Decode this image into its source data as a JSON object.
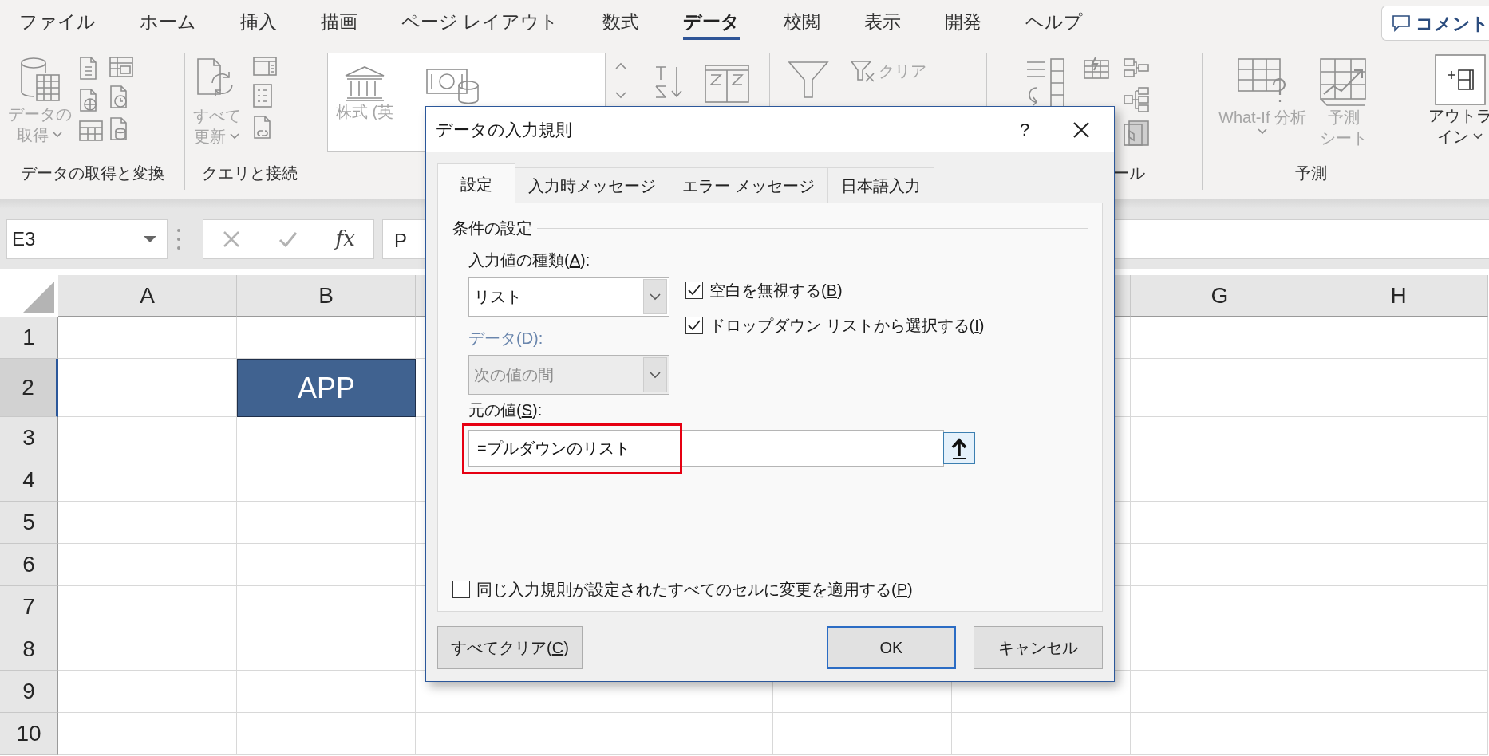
{
  "ribbon_tabs": [
    {
      "label": "ファイル",
      "selected": false
    },
    {
      "label": "ホーム",
      "selected": false
    },
    {
      "label": "挿入",
      "selected": false
    },
    {
      "label": "描画",
      "selected": false
    },
    {
      "label": "ページ レイアウト",
      "selected": false
    },
    {
      "label": "数式",
      "selected": false
    },
    {
      "label": "データ",
      "selected": true
    },
    {
      "label": "校閲",
      "selected": false
    },
    {
      "label": "表示",
      "selected": false
    },
    {
      "label": "開発",
      "selected": false
    },
    {
      "label": "ヘルプ",
      "selected": false
    }
  ],
  "comment_button": {
    "label": "コメント"
  },
  "ribbon_groups": [
    {
      "kind": "getdata",
      "label": "データの取得と変換",
      "buttons": [
        {
          "lines": [
            "データの",
            "取得"
          ],
          "dropdown": true,
          "disabled": true
        }
      ]
    },
    {
      "kind": "queries",
      "label": "クエリと接続",
      "buttons": [
        {
          "lines": [
            "すべて",
            "更新"
          ],
          "dropdown": true,
          "disabled": true
        }
      ]
    },
    {
      "kind": "gallery",
      "buttons": [
        {
          "lines": [
            "株式 (英"
          ],
          "disabled": true
        }
      ]
    },
    {
      "kind": "sort"
    },
    {
      "kind": "filter",
      "buttons": [
        {
          "lines": [
            "クリア"
          ],
          "disabled": true
        }
      ]
    },
    {
      "kind": "tools",
      "label": "ール"
    },
    {
      "kind": "forecast",
      "label": "予測",
      "buttons": [
        {
          "lines": [
            "What-If 分析"
          ],
          "dropdown": true,
          "disabled": true
        },
        {
          "lines": [
            "予測",
            "シート"
          ],
          "disabled": true
        }
      ]
    },
    {
      "kind": "outline",
      "buttons": [
        {
          "lines": [
            "アウトラ",
            "イン"
          ],
          "dropdown": true,
          "disabled": false
        }
      ]
    }
  ],
  "formula_bar": {
    "name_box": "E3",
    "insert_function": "fx",
    "formula": "P"
  },
  "sheet": {
    "columns": [
      "A",
      "B",
      null,
      null,
      null,
      null,
      "G",
      "H"
    ],
    "rows": [
      {
        "label": "1",
        "selected": false
      },
      {
        "label": "2",
        "selected": true,
        "column_b": "APP"
      },
      {
        "label": "3",
        "selected": false
      },
      {
        "label": "4",
        "selected": false
      },
      {
        "label": "5",
        "selected": false
      },
      {
        "label": "6",
        "selected": false
      },
      {
        "label": "7",
        "selected": false
      },
      {
        "label": "8",
        "selected": false
      },
      {
        "label": "9",
        "selected": false
      },
      {
        "label": "10",
        "selected": false
      }
    ]
  },
  "dialog": {
    "title": "データの入力規則",
    "help": "?",
    "tabs": [
      {
        "label": "設定",
        "selected": true
      },
      {
        "label": "入力時メッセージ",
        "selected": false
      },
      {
        "label": "エラー メッセージ",
        "selected": false
      },
      {
        "label": "日本語入力",
        "selected": false
      }
    ],
    "section": "条件の設定",
    "allow": {
      "label": {
        "text": "入力値の種類(",
        "key": "A",
        "rest": "):"
      },
      "value": "リスト",
      "disabled": false
    },
    "data": {
      "label": {
        "text": "データ(D):"
      },
      "value": "次の値の間",
      "disabled": true
    },
    "options": [
      {
        "label": {
          "text": "空白を無視する(",
          "key": "B",
          "rest": ")"
        },
        "checked": true
      },
      {
        "label": {
          "text": "ドロップダウン リストから選択する(",
          "key": "I",
          "rest": ")"
        },
        "checked": true
      }
    ],
    "source": {
      "label": {
        "text": "元の値(",
        "key": "S",
        "rest": "):"
      },
      "value": "=プルダウンのリスト",
      "highlighted": true
    },
    "apply_all": {
      "label": {
        "text": "同じ入力規則が設定されたすべてのセルに変更を適用する(",
        "key": "P",
        "rest": ")"
      },
      "checked": false
    },
    "buttons": [
      {
        "kind": "plain",
        "label": {
          "text": "すべてクリア(",
          "key": "C",
          "rest": ")"
        }
      },
      {
        "kind": "default",
        "label": {
          "text": "OK"
        }
      },
      {
        "kind": "plain",
        "label": {
          "text": "キャンセル"
        }
      }
    ]
  }
}
